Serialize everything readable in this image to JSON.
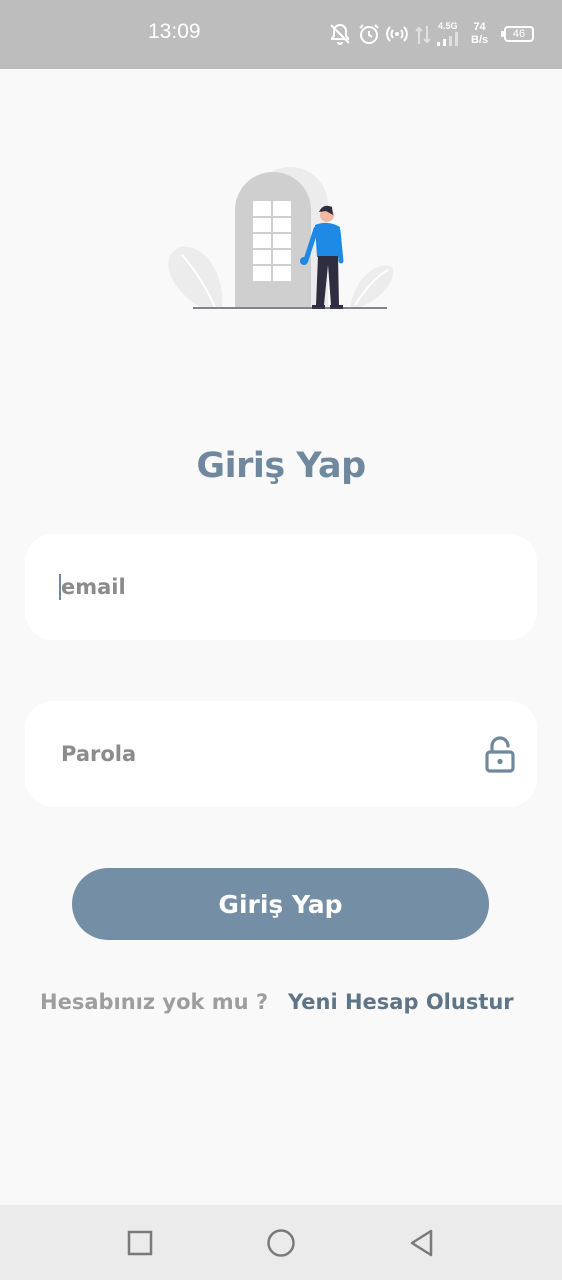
{
  "status_bar": {
    "time": "13:09",
    "network_type": "4.5G",
    "net_speed_value": "74",
    "net_speed_unit": "B/s",
    "battery": "46",
    "icons": [
      "mute-bell-icon",
      "alarm-icon",
      "hotspot-icon",
      "data-arrows-icon",
      "signal-icon",
      "battery-icon"
    ],
    "color": "#bdbdbd"
  },
  "login": {
    "title": "Giriş Yap",
    "email_placeholder": "email",
    "password_placeholder": "Parola",
    "submit_label": "Giriş Yap",
    "no_account_text": "Hesabınız yok mu ?",
    "create_account_link": "Yeni Hesap Olustur"
  },
  "colors": {
    "accent": "#6f889e",
    "button": "#738ea5",
    "link": "#5e7487",
    "background": "#f9f9f9"
  },
  "nav_bar": {
    "buttons": [
      "recents-square-icon",
      "home-circle-icon",
      "back-triangle-icon"
    ]
  }
}
